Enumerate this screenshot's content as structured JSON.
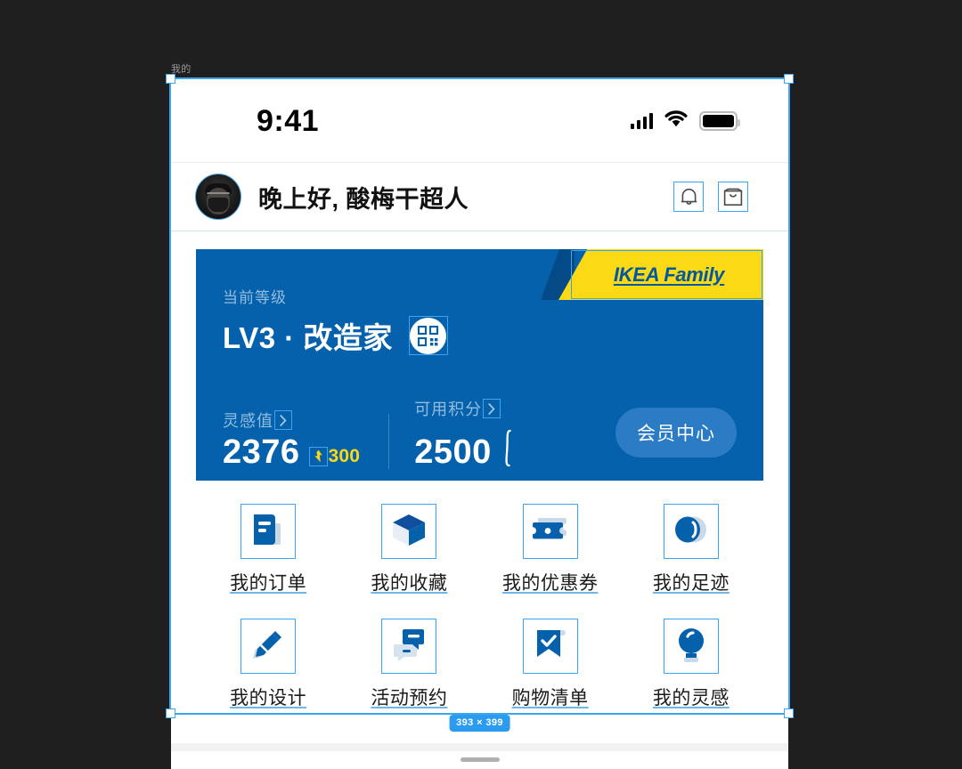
{
  "canvas": {
    "layer_label": "我的",
    "selection_size": "393 × 399",
    "background_color": "#1f1f1f",
    "selection_color": "#3ca5f0"
  },
  "status_bar": {
    "time": "9:41",
    "icons": [
      "cellular-signal-icon",
      "wifi-icon",
      "battery-icon"
    ]
  },
  "header": {
    "avatar_name": "avatar",
    "greeting": "晚上好, 酸梅干超人",
    "actions": [
      {
        "name": "notification-bell-icon",
        "label": "通知"
      },
      {
        "name": "shopping-bag-icon",
        "label": "购物袋"
      }
    ]
  },
  "member_card": {
    "background_color": "#0561AC",
    "ribbon": {
      "text": "IKEA Family",
      "background_color": "#FBD914",
      "text_color": "#0058A3"
    },
    "level_label": "当前等级",
    "level_value": "LV3 · 改造家",
    "qr_icon": "qr-code-icon",
    "stats": [
      {
        "label": "灵感值",
        "value": "2376",
        "delta": "300",
        "delta_color": "#FBD914"
      },
      {
        "label": "可用积分",
        "value": "2500",
        "delta": "",
        "delta_color": ""
      }
    ],
    "member_center_label": "会员中心"
  },
  "shortcuts": [
    {
      "label": "我的订单",
      "icon": "document-order-icon"
    },
    {
      "label": "我的收藏",
      "icon": "box-favorite-icon"
    },
    {
      "label": "我的优惠券",
      "icon": "coupon-ticket-icon"
    },
    {
      "label": "我的足迹",
      "icon": "footprint-icon"
    },
    {
      "label": "我的设计",
      "icon": "pencil-design-icon"
    },
    {
      "label": "活动预约",
      "icon": "chat-bubble-booking-icon"
    },
    {
      "label": "购物清单",
      "icon": "checklist-bookmark-icon"
    },
    {
      "label": "我的灵感",
      "icon": "lightbulb-idea-icon"
    }
  ]
}
